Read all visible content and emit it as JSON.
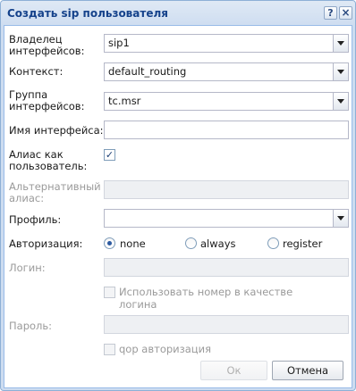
{
  "dialog": {
    "title": "Создать sip пользователя",
    "help_icon": "?",
    "close_icon": "×"
  },
  "form": {
    "owner_label": "Владелец интерфейсов:",
    "owner_value": "sip1",
    "context_label": "Контекст:",
    "context_value": "default_routing",
    "group_label": "Группа интерфейсов:",
    "group_value": "tc.msr",
    "iface_name_label": "Имя интерфейса:",
    "iface_name_value": "",
    "alias_as_user_label": "Алиас как пользователь:",
    "alias_as_user_checked": true,
    "alt_alias_label": "Альтернативный алиас:",
    "alt_alias_value": "",
    "profile_label": "Профиль:",
    "profile_value": "",
    "auth_label": "Авторизация:",
    "auth_options": [
      "none",
      "always",
      "register"
    ],
    "auth_selected": "none",
    "login_label": "Логин:",
    "login_value": "",
    "use_number_label": "Использовать номер в качестве логина",
    "use_number_checked": false,
    "password_label": "Пароль:",
    "password_value": "",
    "qop_label": "qop авторизация",
    "qop_checked": false
  },
  "buttons": {
    "ok": "Ок",
    "cancel": "Отмена"
  }
}
